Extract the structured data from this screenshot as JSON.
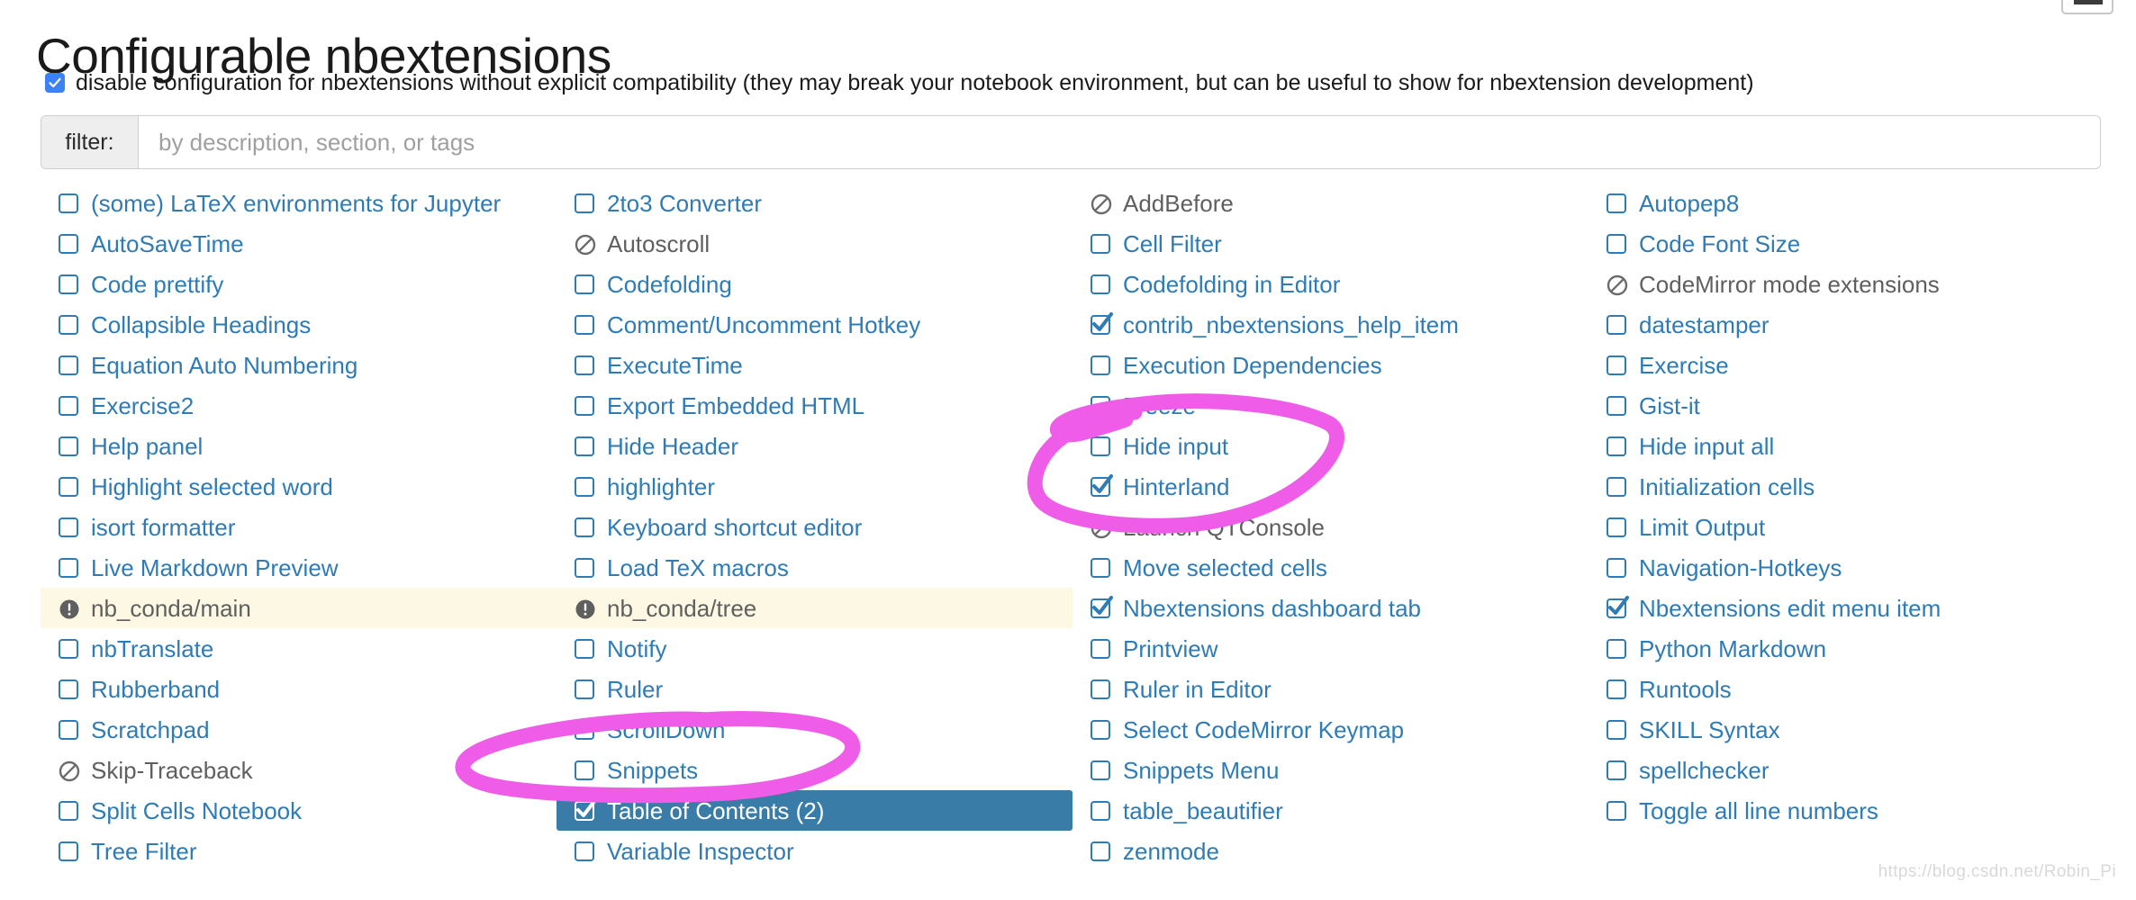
{
  "header": {
    "title": "Configurable nbextensions",
    "disable_checkbox_label": "disable configuration for nbextensions without explicit compatibility (they may break your notebook environment, but can be useful to show for nbextension development)",
    "disable_checkbox_checked": true
  },
  "filter": {
    "label": "filter:",
    "placeholder": "by description, section, or tags",
    "value": ""
  },
  "colors": {
    "link_blue": "#2e7bb5",
    "selected_bg": "#3a7ca8",
    "warn_bg": "#fcf8e3",
    "accent_check": "#3b82f6",
    "marker_pink": "#ef5ce8",
    "disabled_gray": "#5f5f5f"
  },
  "watermark": "https://blog.csdn.net/Robin_Pi",
  "extensions": {
    "columns": [
      {
        "items": [
          {
            "label": "(some) LaTeX environments for Jupyter",
            "state": "unchecked"
          },
          {
            "label": "AutoSaveTime",
            "state": "unchecked"
          },
          {
            "label": "Code prettify",
            "state": "unchecked"
          },
          {
            "label": "Collapsible Headings",
            "state": "unchecked"
          },
          {
            "label": "Equation Auto Numbering",
            "state": "unchecked"
          },
          {
            "label": "Exercise2",
            "state": "unchecked"
          },
          {
            "label": "Help panel",
            "state": "unchecked"
          },
          {
            "label": "Highlight selected word",
            "state": "unchecked"
          },
          {
            "label": "isort formatter",
            "state": "unchecked"
          },
          {
            "label": "Live Markdown Preview",
            "state": "unchecked"
          },
          {
            "label": "nb_conda/main",
            "state": "warning"
          },
          {
            "label": "nbTranslate",
            "state": "unchecked"
          },
          {
            "label": "Rubberband",
            "state": "unchecked"
          },
          {
            "label": "Scratchpad",
            "state": "unchecked"
          },
          {
            "label": "Skip-Traceback",
            "state": "incompatible"
          },
          {
            "label": "Split Cells Notebook",
            "state": "unchecked"
          },
          {
            "label": "Tree Filter",
            "state": "unchecked"
          }
        ]
      },
      {
        "items": [
          {
            "label": "2to3 Converter",
            "state": "unchecked"
          },
          {
            "label": "Autoscroll",
            "state": "incompatible"
          },
          {
            "label": "Codefolding",
            "state": "unchecked"
          },
          {
            "label": "Comment/Uncomment Hotkey",
            "state": "unchecked"
          },
          {
            "label": "ExecuteTime",
            "state": "unchecked"
          },
          {
            "label": "Export Embedded HTML",
            "state": "unchecked"
          },
          {
            "label": "Hide Header",
            "state": "unchecked"
          },
          {
            "label": "highlighter",
            "state": "unchecked"
          },
          {
            "label": "Keyboard shortcut editor",
            "state": "unchecked"
          },
          {
            "label": "Load TeX macros",
            "state": "unchecked"
          },
          {
            "label": "nb_conda/tree",
            "state": "warning"
          },
          {
            "label": "Notify",
            "state": "unchecked"
          },
          {
            "label": "Ruler",
            "state": "unchecked"
          },
          {
            "label": "ScrollDown",
            "state": "unchecked"
          },
          {
            "label": "Snippets",
            "state": "unchecked"
          },
          {
            "label": "Table of Contents (2)",
            "state": "checked",
            "selected": true
          },
          {
            "label": "Variable Inspector",
            "state": "unchecked"
          }
        ]
      },
      {
        "items": [
          {
            "label": "AddBefore",
            "state": "incompatible"
          },
          {
            "label": "Cell Filter",
            "state": "unchecked"
          },
          {
            "label": "Codefolding in Editor",
            "state": "unchecked"
          },
          {
            "label": "contrib_nbextensions_help_item",
            "state": "checked"
          },
          {
            "label": "Execution Dependencies",
            "state": "unchecked"
          },
          {
            "label": "Freeze",
            "state": "unchecked"
          },
          {
            "label": "Hide input",
            "state": "unchecked"
          },
          {
            "label": "Hinterland",
            "state": "checked"
          },
          {
            "label": "Launch QTConsole",
            "state": "incompatible"
          },
          {
            "label": "Move selected cells",
            "state": "unchecked"
          },
          {
            "label": "Nbextensions dashboard tab",
            "state": "checked"
          },
          {
            "label": "Printview",
            "state": "unchecked"
          },
          {
            "label": "Ruler in Editor",
            "state": "unchecked"
          },
          {
            "label": "Select CodeMirror Keymap",
            "state": "unchecked"
          },
          {
            "label": "Snippets Menu",
            "state": "unchecked"
          },
          {
            "label": "table_beautifier",
            "state": "unchecked"
          },
          {
            "label": "zenmode",
            "state": "unchecked"
          }
        ]
      },
      {
        "items": [
          {
            "label": "Autopep8",
            "state": "unchecked"
          },
          {
            "label": "Code Font Size",
            "state": "unchecked"
          },
          {
            "label": "CodeMirror mode extensions",
            "state": "incompatible"
          },
          {
            "label": "datestamper",
            "state": "unchecked"
          },
          {
            "label": "Exercise",
            "state": "unchecked"
          },
          {
            "label": "Gist-it",
            "state": "unchecked"
          },
          {
            "label": "Hide input all",
            "state": "unchecked"
          },
          {
            "label": "Initialization cells",
            "state": "unchecked"
          },
          {
            "label": "Limit Output",
            "state": "unchecked"
          },
          {
            "label": "Navigation-Hotkeys",
            "state": "unchecked"
          },
          {
            "label": "Nbextensions edit menu item",
            "state": "checked"
          },
          {
            "label": "Python Markdown",
            "state": "unchecked"
          },
          {
            "label": "Runtools",
            "state": "unchecked"
          },
          {
            "label": "SKILL Syntax",
            "state": "unchecked"
          },
          {
            "label": "spellchecker",
            "state": "unchecked"
          },
          {
            "label": "Toggle all line numbers",
            "state": "unchecked"
          }
        ]
      }
    ]
  },
  "annotations": [
    {
      "name": "circle-hide-input-hinterland",
      "shape": "ellipse"
    },
    {
      "name": "circle-table-of-contents",
      "shape": "ellipse"
    }
  ]
}
